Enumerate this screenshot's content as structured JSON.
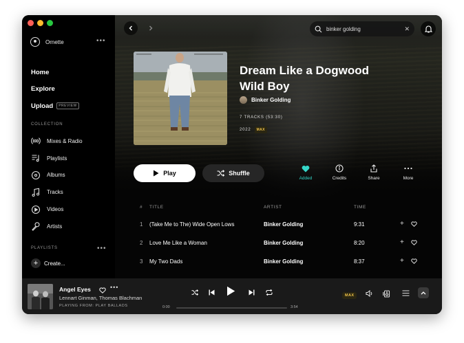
{
  "sidebar": {
    "user_name": "Ornette",
    "more_label": "•••",
    "nav": [
      {
        "label": "Home"
      },
      {
        "label": "Explore"
      },
      {
        "label": "Upload",
        "badge": "PREVIEW"
      }
    ],
    "collection_label": "COLLECTION",
    "collection_items": [
      {
        "label": "Mixes & Radio",
        "icon": "radio-icon"
      },
      {
        "label": "Playlists",
        "icon": "playlist-icon"
      },
      {
        "label": "Albums",
        "icon": "album-icon"
      },
      {
        "label": "Tracks",
        "icon": "note-icon"
      },
      {
        "label": "Videos",
        "icon": "video-icon"
      },
      {
        "label": "Artists",
        "icon": "mic-icon"
      }
    ],
    "playlists_label": "PLAYLISTS",
    "create_label": "Create..."
  },
  "search": {
    "value": "binker golding",
    "placeholder": "Search"
  },
  "album": {
    "title": "Dream Like a Dogwood Wild Boy",
    "artist": "Binker Golding",
    "tracks_info": "7 TRACKS  (53:30)",
    "year": "2022",
    "quality_badge": "MAX"
  },
  "actions": {
    "play": "Play",
    "shuffle": "Shuffle",
    "added": "Added",
    "credits": "Credits",
    "share": "Share",
    "more": "More"
  },
  "table": {
    "headers": {
      "num": "#",
      "title": "TITLE",
      "artist": "ARTIST",
      "time": "TIME"
    },
    "rows": [
      {
        "num": "1",
        "title": "(Take Me to The) Wide Open Lows",
        "artist": "Binker Golding",
        "time": "9:31"
      },
      {
        "num": "2",
        "title": "Love Me Like a Woman",
        "artist": "Binker Golding",
        "time": "8:20"
      },
      {
        "num": "3",
        "title": "My Two Dads",
        "artist": "Binker Golding",
        "time": "8:37"
      }
    ]
  },
  "player": {
    "title": "Angel Eyes",
    "artists": "Lennart Ginman, Thomas Blachman",
    "playing_from": "PLAYING FROM: PLAY BALLADS",
    "time_current": "0:00",
    "time_total": "3:54",
    "progress_fraction": 0,
    "quality_badge": "MAX"
  },
  "colors": {
    "accent_teal": "#35d6c8",
    "max_badge": "#f2c44a"
  }
}
